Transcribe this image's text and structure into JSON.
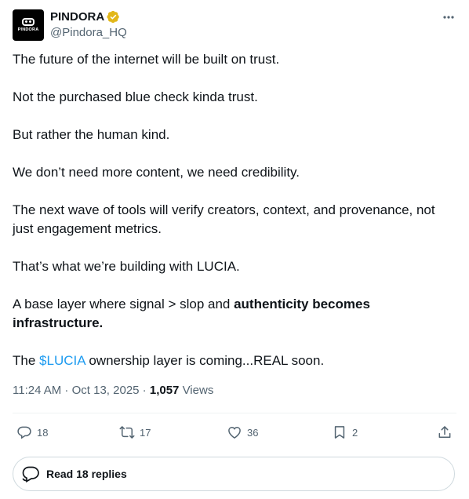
{
  "author": {
    "display_name": "PINDORA",
    "handle": "@Pindora_HQ",
    "avatar_text": "PINDORA",
    "verified_color": "#e2b719"
  },
  "tweet": {
    "p1": "The future of the internet will be built on trust.",
    "p2": "Not the purchased blue check kinda trust.",
    "p3": "But rather the human kind.",
    "p4": "We don’t need more content, we need credibility.",
    "p5": "The next wave of tools will verify creators, context, and provenance, not just engagement metrics.",
    "p6": "That’s what we’re building with LUCIA.",
    "p7_start": "A base layer where signal > slop and ",
    "p7_bold": "authenticity becomes infrastructure.",
    "p8_start": "The ",
    "p8_cashtag": "$LUCIA",
    "p8_end": " ownership layer is coming...REAL soon."
  },
  "meta": {
    "time": "11:24 AM",
    "sep1": " · ",
    "date": "Oct 13, 2025",
    "sep2": " · ",
    "views_count": "1,057",
    "views_label": " Views"
  },
  "actions": {
    "replies": "18",
    "reposts": "17",
    "likes": "36",
    "bookmarks": "2"
  },
  "read_replies": {
    "label": "Read 18 replies"
  },
  "colors": {
    "accent": "#1d9bf0",
    "muted": "#536471",
    "text": "#0f1419",
    "border": "#cfd9de"
  }
}
